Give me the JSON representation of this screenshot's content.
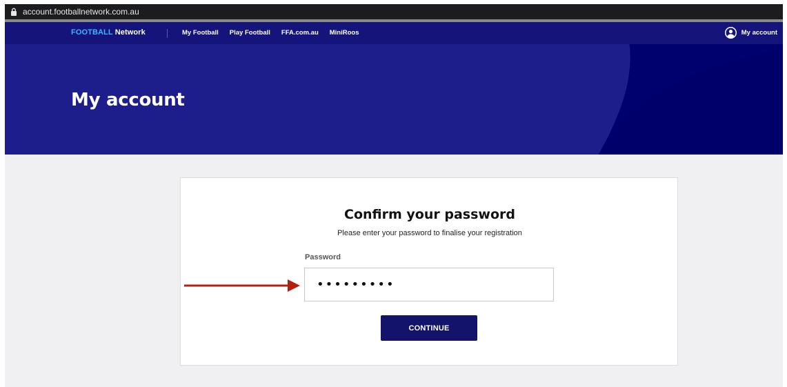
{
  "browser": {
    "url": "account.footballnetwork.com.au",
    "lock_icon": "lock-icon"
  },
  "nav": {
    "brand_bold": "FOOTBALL",
    "brand_rest": "Network",
    "links": [
      "My Football",
      "Play Football",
      "FFA.com.au",
      "MiniRoos"
    ],
    "account_label": "My account",
    "account_icon": "user-circle-icon"
  },
  "hero": {
    "title": "My account"
  },
  "card": {
    "title": "Confirm your password",
    "subtitle": "Please enter your password to finalise your registration",
    "password_label": "Password",
    "password_value": "•••••••••",
    "continue_label": "CONTINUE"
  },
  "colors": {
    "nav_bg": "#14147a",
    "hero_bg": "#1d1d8c",
    "brand_accent": "#3fb3ff",
    "button_bg": "#13136b",
    "arrow": "#b3200f"
  }
}
